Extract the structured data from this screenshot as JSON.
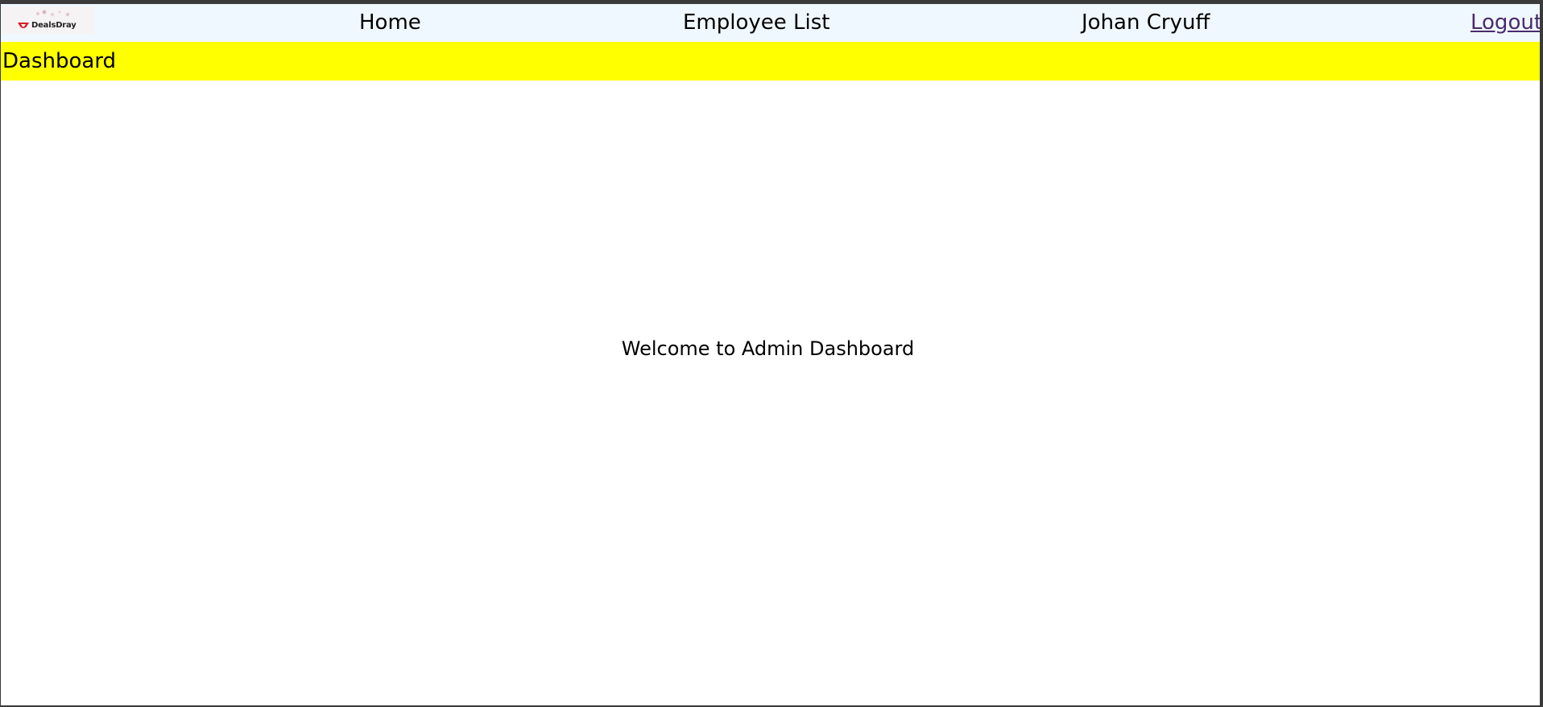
{
  "header": {
    "logo": {
      "text": "DealsDray",
      "brand_color": "#d62027"
    },
    "nav": {
      "home_label": "Home",
      "employee_list_label": "Employee List",
      "user_name": "Johan Cryuff",
      "logout_label": "Logout"
    }
  },
  "page": {
    "title": "Dashboard",
    "title_bar_color": "#ffff00"
  },
  "main": {
    "welcome_text": "Welcome to Admin Dashboard"
  },
  "colors": {
    "navbar_background": "#f0f8ff",
    "logout_link": "#4b2a6e"
  }
}
